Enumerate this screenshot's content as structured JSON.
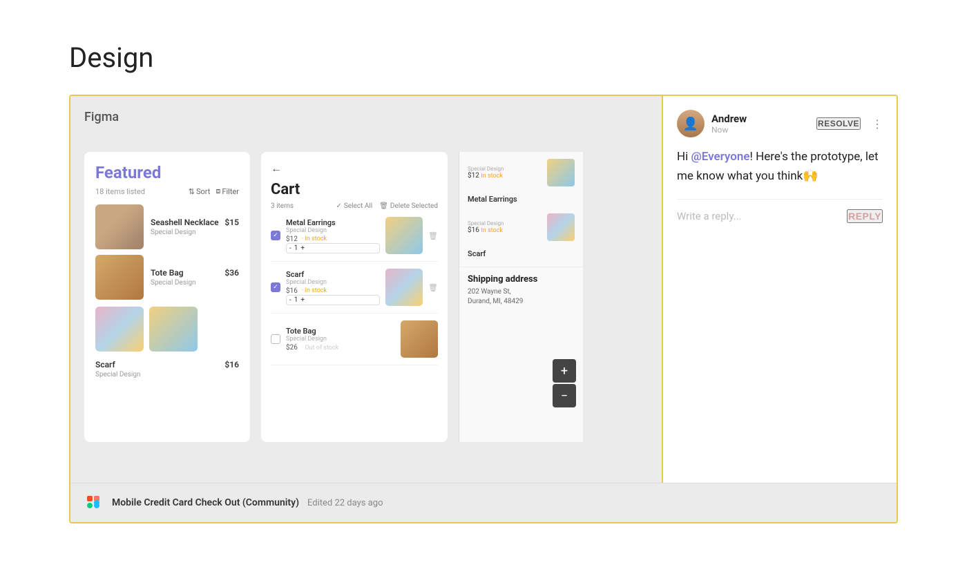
{
  "page": {
    "title": "Design",
    "background": "#ffffff"
  },
  "figma": {
    "label": "Figma",
    "file_name": "Mobile Credit Card Check Out (Community)",
    "edited": "Edited 22 days ago"
  },
  "screen_featured": {
    "title": "Featured",
    "count": "18 items listed",
    "sort_label": "Sort",
    "filter_label": "Filter",
    "items": [
      {
        "name": "Seashell Necklace",
        "price": "$15",
        "brand": "Special Design",
        "img_class": "img-necklace"
      },
      {
        "name": "Tote Bag",
        "price": "$36",
        "brand": "Special Design",
        "img_class": "img-tote"
      },
      {
        "name": "Scarf",
        "price": "$16",
        "brand": "Special Design",
        "img_class": "img-scarf"
      }
    ]
  },
  "screen_cart": {
    "title": "Cart",
    "back_icon": "←",
    "items_count": "3 items",
    "select_all": "Select All",
    "delete_selected": "Delete Selected",
    "items": [
      {
        "name": "Metal Earrings",
        "brand": "Special Design",
        "price": "$12",
        "stock": "In stock",
        "qty": "1",
        "checked": true,
        "img_class": "img-earring"
      },
      {
        "name": "Scarf",
        "brand": "Special Design",
        "price": "$16",
        "stock": "In stock",
        "qty": "1",
        "checked": true,
        "img_class": "img-scarf"
      },
      {
        "name": "Tote Bag",
        "brand": "Special Design",
        "price": "$26",
        "stock": "Out of stock",
        "qty": "1",
        "checked": false,
        "img_class": "img-tote"
      }
    ]
  },
  "right_panel": {
    "items": [
      {
        "name": "Metal Earrings",
        "brand": "Special Design",
        "price": "$12",
        "stock": "In stock",
        "img_class": "img-earring"
      },
      {
        "name": "Scarf",
        "brand": "Special Design",
        "price": "$16",
        "stock": "In stock",
        "img_class": "img-scarf"
      }
    ],
    "shipping": {
      "title": "Shipping address",
      "line1": "202 Wayne St,",
      "line2": "Durand, MI, 48429"
    },
    "zoom_plus": "+",
    "zoom_minus": "−"
  },
  "comment": {
    "author": "Andrew",
    "time": "Now",
    "resolve_label": "RESOLVE",
    "more_icon": "⋮",
    "body_pre": "Hi ",
    "mention": "@Everyone",
    "body_post": "! Here's the prototype, let me know what you think",
    "emoji": "🙌",
    "reply_placeholder": "Write a reply...",
    "reply_label": "REPLY"
  }
}
